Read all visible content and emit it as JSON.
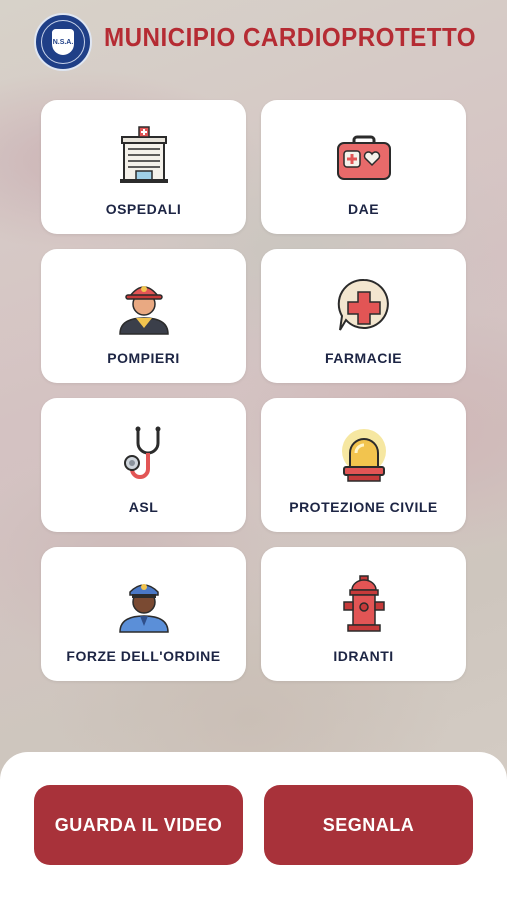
{
  "header": {
    "title": "MUNICIPIO  CARDIOPROTETTO",
    "logo_text": "N.S.A."
  },
  "services": [
    {
      "label": "OSPEDALI",
      "icon": "hospital-icon"
    },
    {
      "label": "DAE",
      "icon": "defibrillator-icon"
    },
    {
      "label": "POMPIERI",
      "icon": "firefighter-icon"
    },
    {
      "label": "FARMACIE",
      "icon": "pharmacy-cross-icon"
    },
    {
      "label": "ASL",
      "icon": "stethoscope-icon"
    },
    {
      "label": "PROTEZIONE CIVILE",
      "icon": "siren-icon"
    },
    {
      "label": "FORZE DELL'ORDINE",
      "icon": "police-officer-icon"
    },
    {
      "label": "IDRANTI",
      "icon": "fire-hydrant-icon"
    }
  ],
  "actions": {
    "video_label": "GUARDA IL VIDEO",
    "report_label": "SEGNALA"
  },
  "colors": {
    "title": "#b52b33",
    "button": "#a8323a",
    "card_text": "#1d2544"
  }
}
